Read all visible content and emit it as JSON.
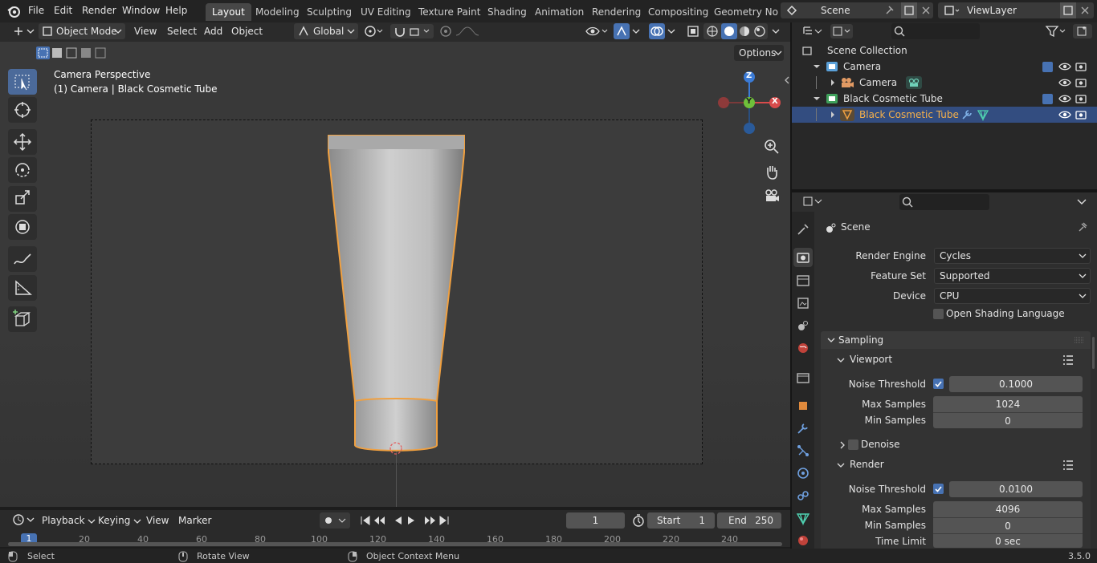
{
  "topbar": {
    "menus": [
      "File",
      "Edit",
      "Render",
      "Window",
      "Help"
    ],
    "workspaces": [
      "Layout",
      "Modeling",
      "Sculpting",
      "UV Editing",
      "Texture Paint",
      "Shading",
      "Animation",
      "Rendering",
      "Compositing",
      "Geometry Noc"
    ],
    "active_workspace": "Layout",
    "scene": "Scene",
    "view_layer": "ViewLayer"
  },
  "viewport_header": {
    "mode": "Object Mode",
    "menus": [
      "View",
      "Select",
      "Add",
      "Object"
    ],
    "transform_orientation": "Global",
    "options_label": "Options"
  },
  "viewport": {
    "camera_label": "Camera Perspective",
    "object_label": "(1) Camera | Black Cosmetic Tube",
    "gizmo": {
      "x": "X",
      "y": "Y",
      "z": "Z"
    },
    "colors": {
      "selection_outline": "#f0a040",
      "active_tool": "#4b6a9a"
    }
  },
  "timeline": {
    "menus": [
      "Playback",
      "Keying",
      "View",
      "Marker"
    ],
    "current_frame": "1",
    "start_label": "Start",
    "start_value": "1",
    "end_label": "End",
    "end_value": "250",
    "ruler": [
      "1",
      "20",
      "40",
      "60",
      "80",
      "100",
      "120",
      "140",
      "160",
      "180",
      "200",
      "220",
      "240"
    ]
  },
  "status": {
    "select": "Select",
    "rotate": "Rotate View",
    "context": "Object Context Menu",
    "version": "3.5.0"
  },
  "outliner": {
    "root": "Scene Collection",
    "rows": [
      {
        "label": "Camera",
        "kind": "collection"
      },
      {
        "label": "Camera",
        "kind": "object"
      },
      {
        "label": "Black Cosmetic Tube",
        "kind": "collection"
      },
      {
        "label": "Black Cosmetic Tube",
        "kind": "object",
        "selected": true
      }
    ]
  },
  "properties": {
    "context_title": "Scene",
    "render_engine_label": "Render Engine",
    "render_engine": "Cycles",
    "feature_set_label": "Feature Set",
    "feature_set": "Supported",
    "device_label": "Device",
    "device": "CPU",
    "osl_label": "Open Shading Language",
    "sampling": "Sampling",
    "viewport": {
      "title": "Viewport",
      "noise_threshold_label": "Noise Threshold",
      "noise_threshold": "0.1000",
      "max_samples_label": "Max Samples",
      "max_samples": "1024",
      "min_samples_label": "Min Samples",
      "min_samples": "0"
    },
    "denoise_label": "Denoise",
    "render": {
      "title": "Render",
      "noise_threshold_label": "Noise Threshold",
      "noise_threshold": "0.0100",
      "max_samples_label": "Max Samples",
      "max_samples": "4096",
      "min_samples_label": "Min Samples",
      "min_samples": "0",
      "time_limit_label": "Time Limit",
      "time_limit": "0 sec"
    }
  }
}
